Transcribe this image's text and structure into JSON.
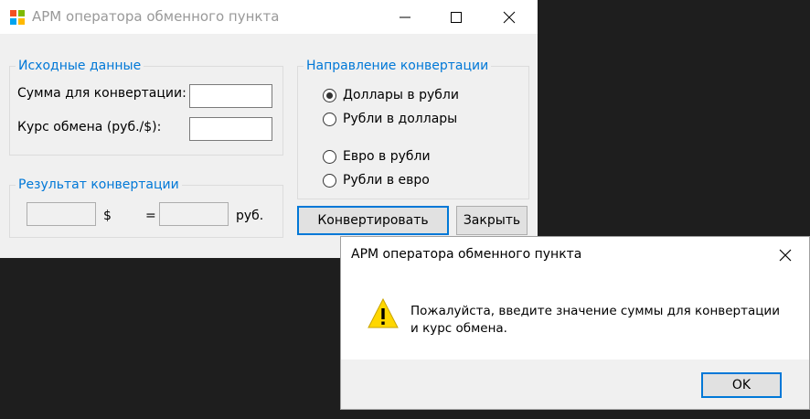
{
  "window": {
    "title": "АРМ оператора обменного пункта",
    "accent": "#0078d7"
  },
  "input_group": {
    "legend": "Исходные данные",
    "amount_label": "Сумма для конвертации:",
    "amount_value": "",
    "rate_label": "Курс обмена (руб./$):",
    "rate_value": ""
  },
  "direction_group": {
    "legend": "Направление конвертации",
    "options": [
      {
        "label": "Доллары в рубли",
        "selected": true
      },
      {
        "label": "Рубли в доллары",
        "selected": false
      },
      {
        "label": "Евро в рубли",
        "selected": false
      },
      {
        "label": "Рубли в евро",
        "selected": false
      }
    ]
  },
  "result_group": {
    "legend": "Результат конвертации",
    "currency_from": "$",
    "equals": "=",
    "currency_to": "руб.",
    "from_value": "",
    "to_value": ""
  },
  "buttons": {
    "convert": "Конвертировать",
    "close": "Закрыть"
  },
  "dialog": {
    "title": "АРМ оператора обменного пункта",
    "message": "Пожалуйста, введите значение суммы для конвертации и курс обмена.",
    "ok": "OK",
    "icon": "warning-icon",
    "icon_color": "#ffd700"
  }
}
